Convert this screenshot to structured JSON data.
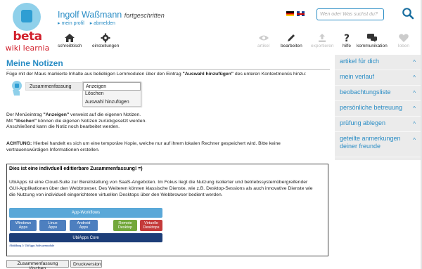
{
  "header": {
    "logo_beta": "beta",
    "logo_wiki": "wiki learnia",
    "user_name": "Ingolf Waßmann",
    "user_level": "fortgeschritten",
    "link_profile": "▸ mein profil",
    "link_logout": "▸ abmelden",
    "search_placeholder": "Wen oder Was suchst du?"
  },
  "toolbar": {
    "desk": "schreibtisch",
    "settings": "einstellungen",
    "article": "artikel",
    "edit": "bearbeiten",
    "export": "exportieren",
    "help": "hilfe",
    "communication": "kommunikation",
    "like": "loben"
  },
  "sidebar": {
    "items": [
      {
        "label": "artikel für dich",
        "caret": "^"
      },
      {
        "label": "mein verlauf",
        "caret": "^"
      },
      {
        "label": "beobachtungsliste",
        "caret": "^"
      },
      {
        "label": "persönliche betreuung",
        "caret": "^"
      },
      {
        "label": "prüfung ablegen",
        "caret": "^"
      },
      {
        "label_line1": "geteilte anmerkungen",
        "label_line2": "deiner freunde",
        "caret": "^"
      }
    ]
  },
  "main": {
    "title": "Meine Notizen",
    "intro_pre": "Füge mit der Maus markierte Inhalte aus beliebigen Lernmodulen über den Eintrag ",
    "intro_bold": "\"Auswahl hinzufügen\"",
    "intro_post": " des unteren Kontextmenüs hinzu:",
    "demo_summary": "Zusammenfassung",
    "demo_arrow": "▸",
    "menu_items": [
      "Anzeigen",
      "Löschen",
      "Auswahl hinzufügen"
    ],
    "line1_pre": "Der Menüeintrag ",
    "line1_bold": "\"Anzeigen\"",
    "line1_post": " verweist auf die eigenen Notizen.",
    "line2_pre": "Mit ",
    "line2_bold": "\"löschen\"",
    "line2_post": " können die eigenen Notizen zurückgesetzt werden.",
    "line3": "Anschließend kann die Notiz noch bearbeitet werden.",
    "warn_bold": "ACHTUNG:",
    "warn_text": " Hierbei handelt es sich um eine temporäre Kopie, welche nur auf ihrem lokalen Rechner gespeichert wird. Bitte keine",
    "warn_text2": "vertrauenswürdigen Informationen erstellen."
  },
  "editable": {
    "title": "Dies ist eine indivduell editierbare Zusammenfassung! =)",
    "text_l1": "UbiApps ist eine Cloud-Suite zur Bereitstellung von SaaS-Angeboten. Im Fokus liegt die Nutzung isolierter und betriebssystemübergreifender",
    "text_l2": "GUI-Applikationen über den Webbrowser. Des Weiteren können klassische Dienste, wie z.B. Desktop-Sessions als auch innovative Dienste wie",
    "text_l3": "die Nutzung von individuell eingerichteten virtuellen Desktops über den Webbrowser bedient werden.",
    "diagram": {
      "workflows": "App-Workflows",
      "windows_l1": "Windows",
      "windows_l2": "Apps",
      "linux_l1": "Linux",
      "linux_l2": "Apps",
      "android_l1": "Android",
      "android_l2": "Apps",
      "remote_l1": "Remote",
      "remote_l2": "Desktop",
      "virtual_l1": "Virtuelle",
      "virtual_l2": "Desktops",
      "core": "UbiApps Core",
      "caption": "Abbildung 1: UbiApps Softwaremodule"
    }
  },
  "buttons": {
    "clear": "Zusammenfassung löschen",
    "print": "Druckversion"
  },
  "colors": {
    "accent": "#2a8dc5",
    "logo_red": "#d11f2b",
    "sidebar_bg": "#ebebeb"
  }
}
